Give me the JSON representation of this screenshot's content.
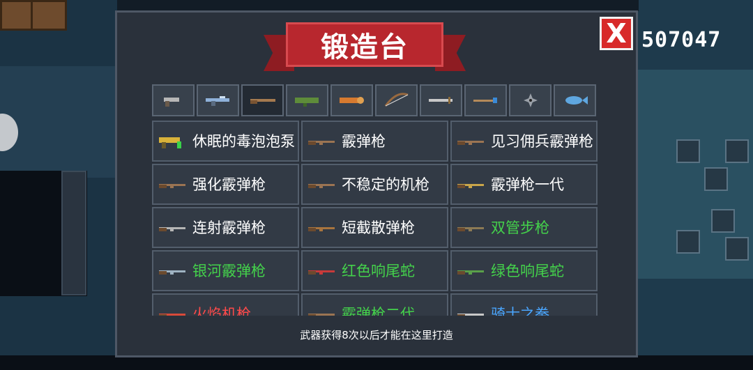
{
  "title": "锻造台",
  "close_label": "X",
  "coins": "507047",
  "tabs": [
    {
      "name": "pistol-icon",
      "color": "#b7b7b7"
    },
    {
      "name": "rifle-icon",
      "color": "#8fb1d9"
    },
    {
      "name": "shotgun-icon",
      "color": "#a57a4f"
    },
    {
      "name": "launcher-icon",
      "color": "#5e8c3a"
    },
    {
      "name": "cannon-icon",
      "color": "#d77a2f"
    },
    {
      "name": "bow-icon",
      "color": "#9a6a3f"
    },
    {
      "name": "blade-icon",
      "color": "#c8c8c8"
    },
    {
      "name": "staff-icon",
      "color": "#b58a5a"
    },
    {
      "name": "shuriken-icon",
      "color": "#9aa0a8"
    },
    {
      "name": "fish-icon",
      "color": "#5fa7e0"
    }
  ],
  "items": [
    {
      "name": "休眠的毒泡泡泵",
      "color": "white",
      "icon": "bubble-pump-icon",
      "icon_color": "#d8b23a"
    },
    {
      "name": "霰弹枪",
      "color": "white",
      "icon": "shotgun-icon",
      "icon_color": "#9b7452"
    },
    {
      "name": "见习佣兵霰弹枪",
      "color": "white",
      "icon": "shotgun-icon",
      "icon_color": "#9b7452"
    },
    {
      "name": "强化霰弹枪",
      "color": "white",
      "icon": "shotgun-icon",
      "icon_color": "#9b7452"
    },
    {
      "name": "不稳定的机枪",
      "color": "white",
      "icon": "shotgun-icon",
      "icon_color": "#9b7452"
    },
    {
      "name": "霰弹枪一代",
      "color": "white",
      "icon": "shotgun-icon",
      "icon_color": "#c9a54a"
    },
    {
      "name": "连射霰弹枪",
      "color": "white",
      "icon": "shotgun-icon",
      "icon_color": "#b5b5b5"
    },
    {
      "name": "短截散弹枪",
      "color": "white",
      "icon": "shotgun-icon",
      "icon_color": "#a8743e"
    },
    {
      "name": "双管步枪",
      "color": "green",
      "icon": "shotgun-icon",
      "icon_color": "#8c7a54"
    },
    {
      "name": "银河霰弹枪",
      "color": "green",
      "icon": "shotgun-icon",
      "icon_color": "#9fb3c2"
    },
    {
      "name": "红色响尾蛇",
      "color": "green",
      "icon": "shotgun-icon",
      "icon_color": "#c83a3a"
    },
    {
      "name": "绿色响尾蛇",
      "color": "green",
      "icon": "shotgun-icon",
      "icon_color": "#5aa04a"
    },
    {
      "name": "火焰机枪",
      "color": "red",
      "icon": "shotgun-icon",
      "icon_color": "#d84a3a"
    },
    {
      "name": "霰弹枪二代",
      "color": "green",
      "icon": "shotgun-icon",
      "icon_color": "#9b7452"
    },
    {
      "name": "骑士之拳",
      "color": "blue",
      "icon": "shotgun-icon",
      "icon_color": "#c8c8c8"
    }
  ],
  "footer": "武器获得8次以后才能在这里打造",
  "colors": {
    "white": "#ffffff",
    "green": "#44d24b",
    "blue": "#4aa6ff",
    "red": "#ff4a4a"
  }
}
